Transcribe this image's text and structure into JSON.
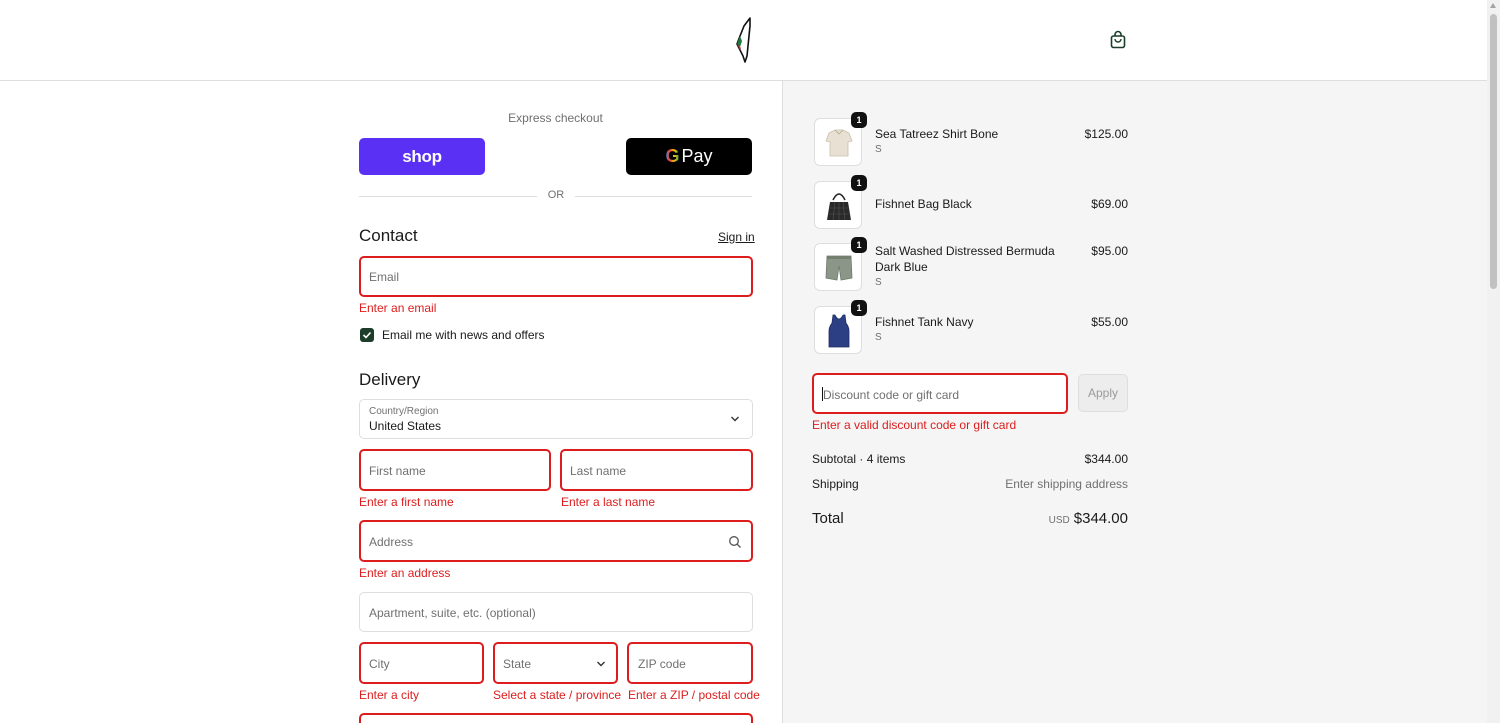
{
  "header": {
    "logo_icon": "palestine-map-logo",
    "cart_icon": "shopping-bag-icon"
  },
  "express": {
    "label": "Express checkout",
    "shop_label": "shop",
    "gpay_label": "Pay",
    "gpay_g": "G",
    "or_label": "OR"
  },
  "contact": {
    "title": "Contact",
    "signin_label": "Sign in",
    "email_placeholder": "Email",
    "email_error": "Enter an email",
    "newsletter_label": "Email me with news and offers",
    "newsletter_checked": true
  },
  "delivery": {
    "title": "Delivery",
    "country_label": "Country/Region",
    "country_value": "United States",
    "first_name_placeholder": "First name",
    "first_name_error": "Enter a first name",
    "last_name_placeholder": "Last name",
    "last_name_error": "Enter a last name",
    "address_placeholder": "Address",
    "address_error": "Enter an address",
    "apartment_placeholder": "Apartment, suite, etc. (optional)",
    "city_placeholder": "City",
    "city_error": "Enter a city",
    "state_placeholder": "State",
    "state_error": "Select a state / province",
    "zip_placeholder": "ZIP code",
    "zip_error": "Enter a ZIP / postal code"
  },
  "cart": {
    "items": [
      {
        "name": "Sea Tatreez Shirt Bone",
        "variant": "S",
        "price": "$125.00",
        "qty": "1"
      },
      {
        "name": "Fishnet Bag Black",
        "variant": "",
        "price": "$69.00",
        "qty": "1"
      },
      {
        "name": "Salt Washed Distressed Bermuda Dark Blue",
        "variant": "S",
        "price": "$95.00",
        "qty": "1"
      },
      {
        "name": "Fishnet Tank Navy",
        "variant": "S",
        "price": "$55.00",
        "qty": "1"
      }
    ],
    "discount_placeholder": "Discount code or gift card",
    "discount_error": "Enter a valid discount code or gift card",
    "apply_label": "Apply",
    "subtotal_label": "Subtotal · 4 items",
    "subtotal_value": "$344.00",
    "shipping_label": "Shipping",
    "shipping_value": "Enter shipping address",
    "total_label": "Total",
    "total_currency": "USD",
    "total_value": "$344.00"
  },
  "colors": {
    "shop_purple": "#5a31f4",
    "error_red": "#dd1d1d",
    "checkbox_green": "#1d3d2b"
  }
}
